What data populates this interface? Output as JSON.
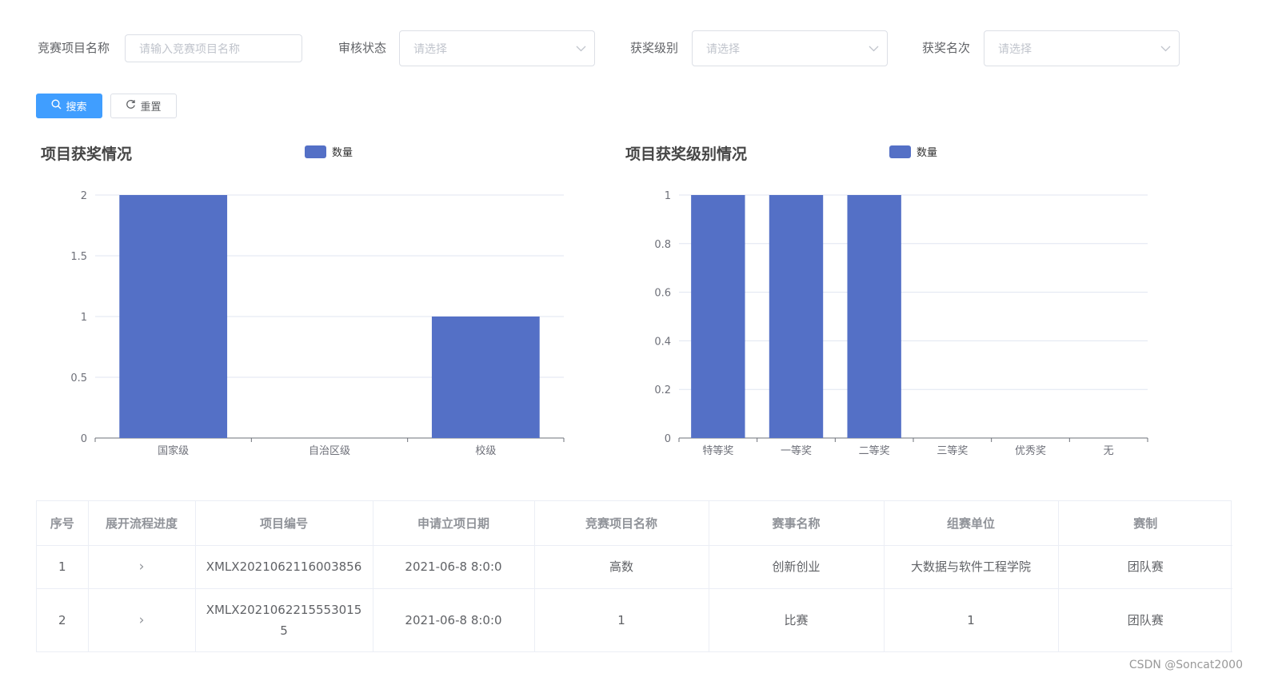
{
  "filters": {
    "project_name": {
      "label": "竞赛项目名称",
      "placeholder": "请输入竞赛项目名称"
    },
    "review_status": {
      "label": "审核状态",
      "placeholder": "请选择"
    },
    "award_level": {
      "label": "获奖级别",
      "placeholder": "请选择"
    },
    "award_rank": {
      "label": "获奖名次",
      "placeholder": "请选择"
    }
  },
  "buttons": {
    "search": "搜索",
    "reset": "重置"
  },
  "colors": {
    "primary": "#409eff",
    "bar": "#5470c6"
  },
  "chart_data": [
    {
      "type": "bar",
      "title": "项目获奖情况",
      "categories": [
        "国家级",
        "自治区级",
        "校级"
      ],
      "series": [
        {
          "name": "数量",
          "values": [
            2,
            0,
            1
          ]
        }
      ],
      "yticks": [
        "0",
        "0.5",
        "1",
        "1.5",
        "2"
      ],
      "ylim": [
        0,
        2
      ],
      "grid": true,
      "legend": "top"
    },
    {
      "type": "bar",
      "title": "项目获奖级别情况",
      "categories": [
        "特等奖",
        "一等奖",
        "二等奖",
        "三等奖",
        "优秀奖",
        "无"
      ],
      "series": [
        {
          "name": "数量",
          "values": [
            1,
            1,
            1,
            0,
            0,
            0
          ]
        }
      ],
      "yticks": [
        "0",
        "0.2",
        "0.4",
        "0.6",
        "0.8",
        "1"
      ],
      "ylim": [
        0,
        1
      ],
      "grid": true,
      "legend": "top"
    }
  ],
  "table": {
    "columns": [
      "序号",
      "展开流程进度",
      "项目编号",
      "申请立项日期",
      "竞赛项目名称",
      "赛事名称",
      "组赛单位",
      "赛制"
    ],
    "rows": [
      {
        "index": "1",
        "expand": "›",
        "project_no": "XMLX2021062116003856",
        "date": "2021-06-8 8:0:0",
        "project_name": "高数",
        "event_name": "创新创业",
        "organizer": "大数据与软件工程学院",
        "format": "团队赛"
      },
      {
        "index": "2",
        "expand": "›",
        "project_no": "XMLX20210622155530155",
        "date": "2021-06-8 8:0:0",
        "project_name": "1",
        "event_name": "比赛",
        "organizer": "1",
        "format": "团队赛"
      }
    ]
  },
  "watermark": "CSDN @Soncat2000"
}
